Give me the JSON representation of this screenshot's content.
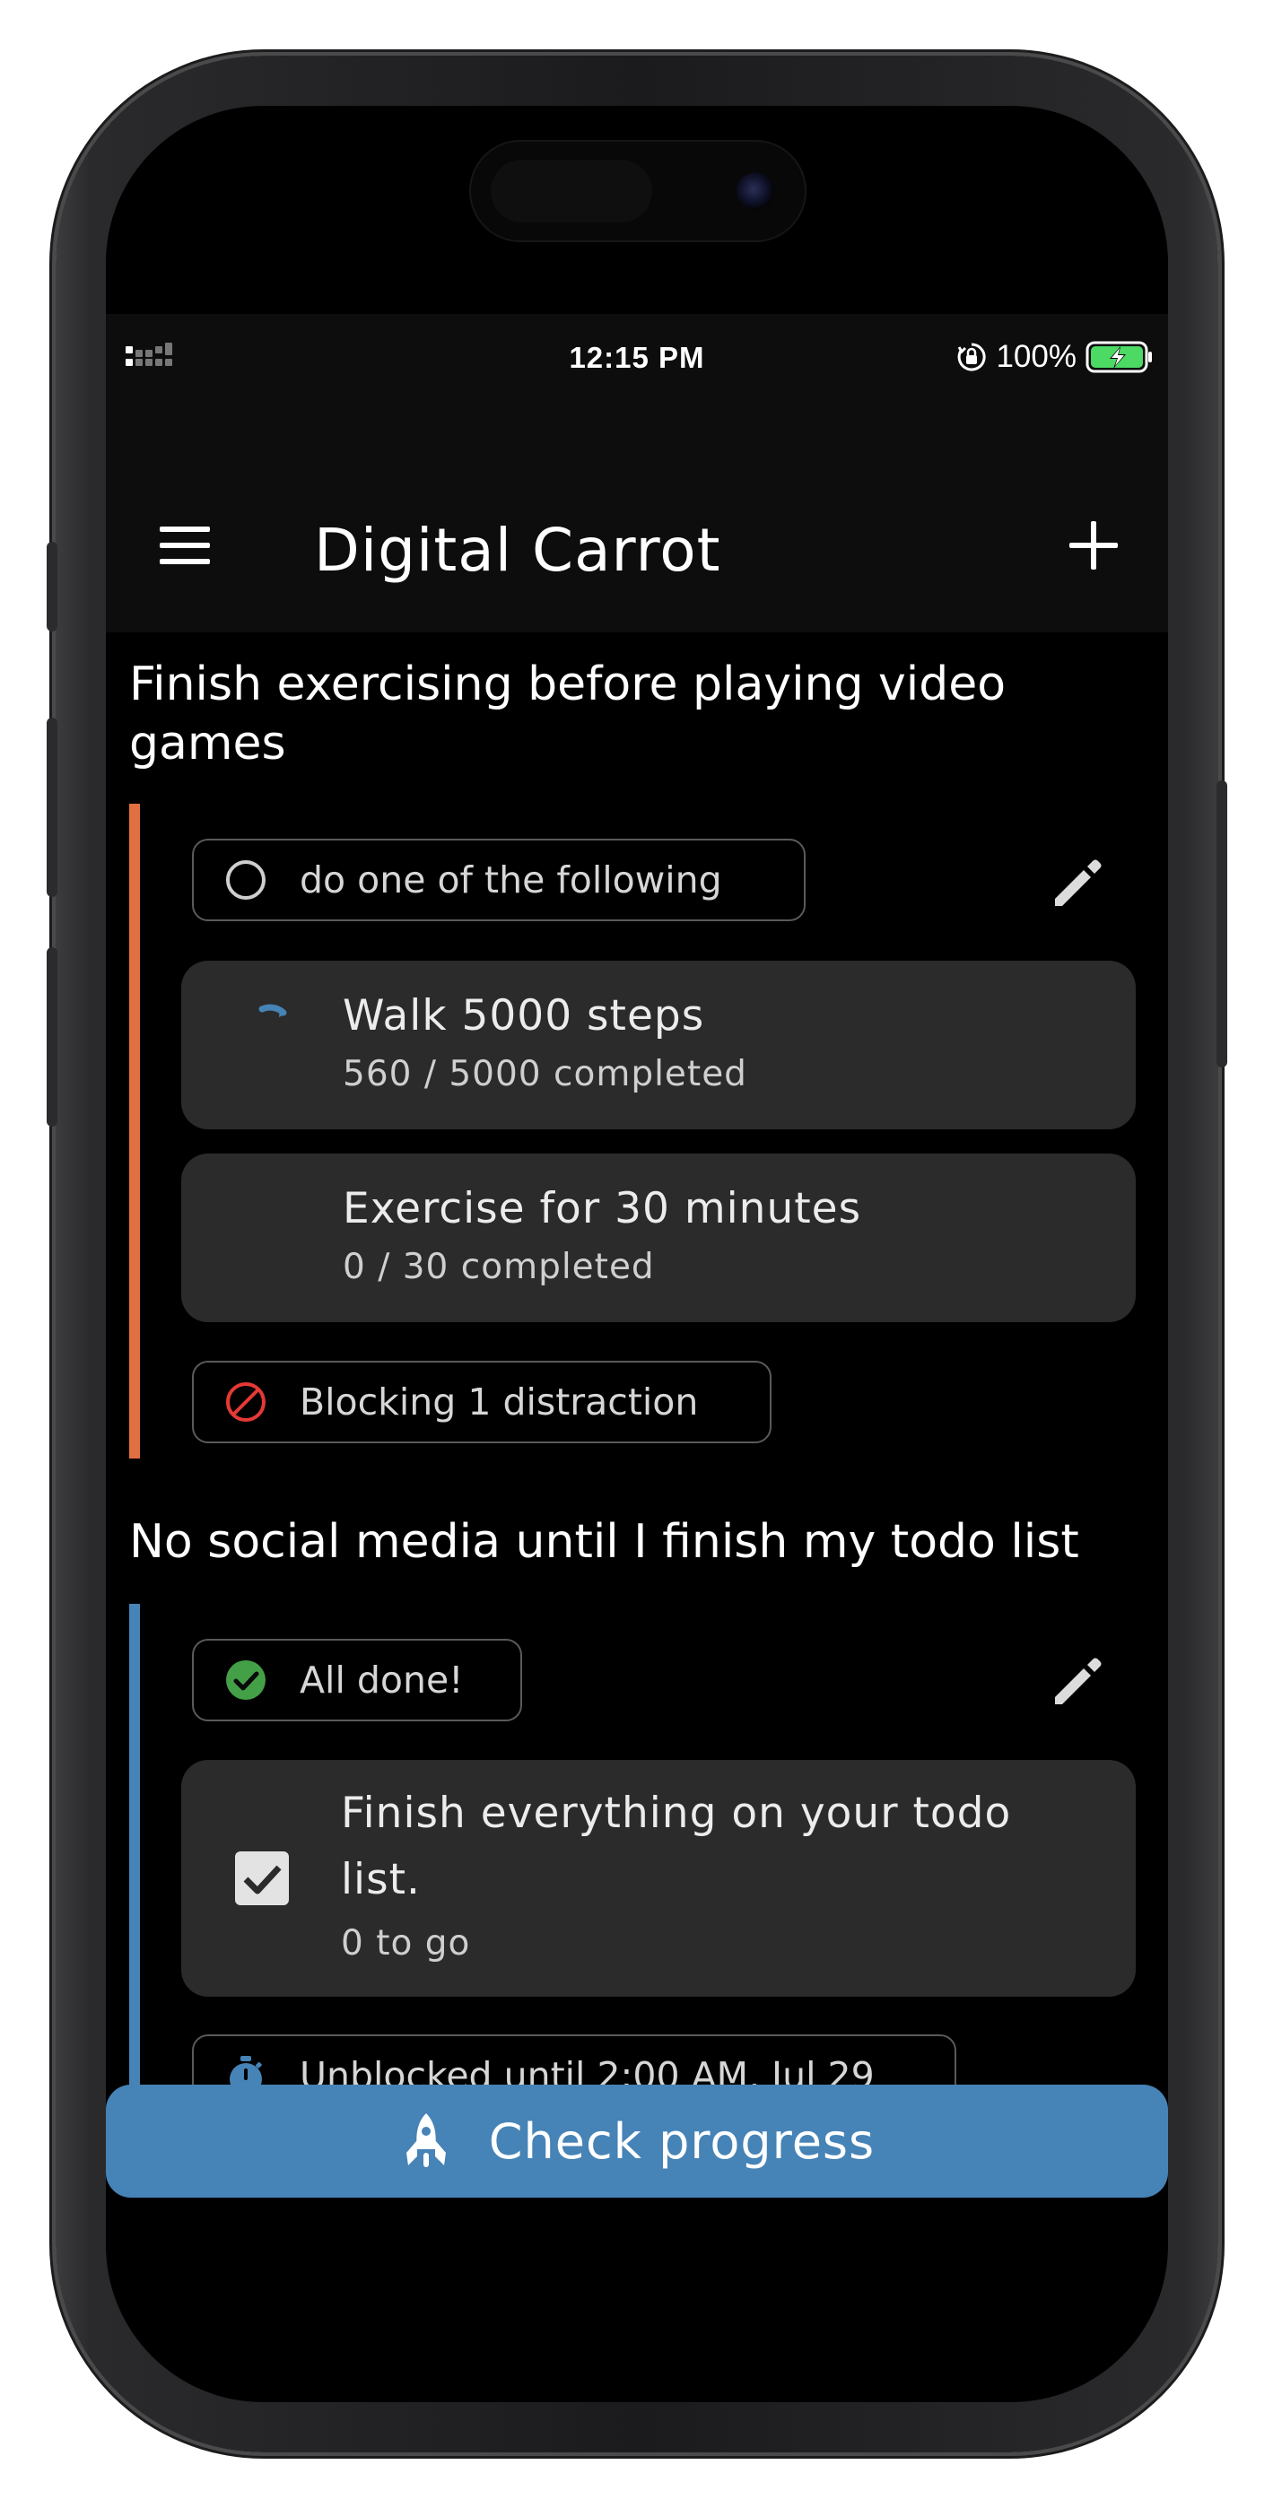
{
  "status_bar": {
    "time": "12:15 PM",
    "battery": "100%",
    "icons": [
      "signal-icon",
      "rotation-lock-icon",
      "battery-charging-icon"
    ]
  },
  "app_bar": {
    "title": "Digital Carrot",
    "icons": [
      "menu-icon",
      "add-icon"
    ]
  },
  "goals": [
    {
      "title": "Finish exercising before playing video games",
      "accent_color": "#e0703f",
      "mode_label": "do one of the following",
      "mode_icon": "empty-circle-icon",
      "tasks": [
        {
          "title": "Walk 5000 steps",
          "progress_text": "560 / 5000 completed",
          "progress": 0.112,
          "icon": "progress-arc-icon"
        },
        {
          "title": "Exercise for 30 minutes",
          "progress_text": "0 / 30 completed",
          "progress": 0
        }
      ],
      "status_label": "Blocking 1 distraction",
      "status_icon": "blocked-icon"
    },
    {
      "title": "No social media until I finish my todo list",
      "accent_color": "#4683b6",
      "mode_label": "All done!",
      "mode_icon": "check-circle-icon",
      "tasks": [
        {
          "title_line1": "Finish everything on your todo",
          "title_line2": "list.",
          "progress_text": "0 to go",
          "checked": true,
          "icon": "checkbox-checked-icon"
        }
      ],
      "status_label": "Unblocked until 2:00 AM, Jul 29",
      "status_icon": "stopwatch-icon"
    }
  ],
  "cta": {
    "label": "Check progress",
    "icon": "rocket-icon",
    "color": "#4683b6"
  },
  "colors": {
    "background": "#000000",
    "app_bar": "#0d0d0d",
    "card": "#2b2b2b",
    "danger": "#e53935",
    "success": "#43a047",
    "accent": "#4683b6"
  }
}
